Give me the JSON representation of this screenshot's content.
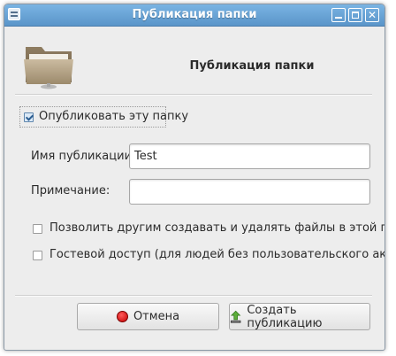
{
  "window": {
    "title": "Публикация папки"
  },
  "header": {
    "title": "Публикация папки",
    "icon": "folder-icon"
  },
  "share": {
    "checkbox_label": "Опубликовать эту папку",
    "checked": true
  },
  "form": {
    "name_label": "Имя публикации:",
    "name_value": "Test",
    "comment_label": "Примечание:",
    "comment_value": ""
  },
  "options": {
    "allow_write_label": "Позволить другим создавать и удалять файлы в этой папке",
    "allow_write_checked": false,
    "guest_label": "Гостевой доступ (для людей без пользовательского аккаунта)",
    "guest_checked": false
  },
  "buttons": {
    "cancel_label": "Отмена",
    "create_label": "Создать публикацию"
  },
  "colors": {
    "titlebar": "#6aa6d8",
    "accent": "#2d5f92",
    "cancel_icon": "#d00000",
    "create_icon": "#4a9a2a"
  }
}
